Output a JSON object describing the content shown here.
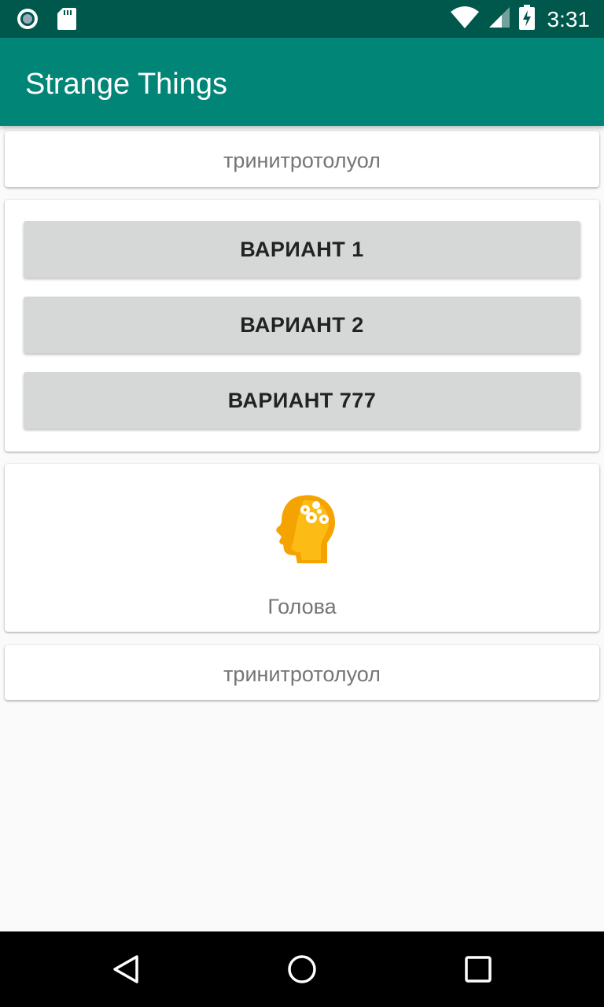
{
  "status_bar": {
    "time": "3:31",
    "icons": [
      "record-icon",
      "sd-card-icon",
      "wifi-icon",
      "signal-icon",
      "battery-charging-icon"
    ]
  },
  "app_bar": {
    "title": "Strange Things"
  },
  "cards": {
    "top_text": "тринитротолуол",
    "buttons": [
      "ВАРИАНТ 1",
      "ВАРИАНТ 2",
      "ВАРИАНТ 777"
    ],
    "image_caption": "Голова",
    "bottom_text": "тринитротолуол"
  },
  "nav_bar": {
    "icons": [
      "back-icon",
      "home-icon",
      "recents-icon"
    ]
  },
  "colors": {
    "status_bar": "#00574b",
    "app_bar": "#008577",
    "button": "#d6d7d7",
    "head_icon": "#f5a300"
  }
}
